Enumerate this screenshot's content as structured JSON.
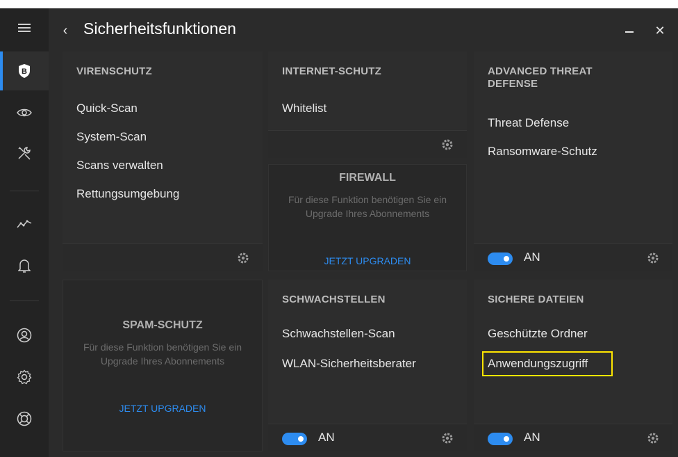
{
  "titlebar": {
    "back_glyph": "‹",
    "title": "Sicherheitsfunktionen",
    "close_glyph": "✕"
  },
  "sidebar": {
    "items": [
      {
        "icon": "menu-icon"
      },
      {
        "icon": "bitdefender-shield-icon",
        "glyph": "B",
        "active": true
      },
      {
        "icon": "eye-icon"
      },
      {
        "icon": "tools-icon"
      },
      {
        "icon": "activity-graph-icon"
      },
      {
        "icon": "bell-icon"
      },
      {
        "icon": "account-icon"
      },
      {
        "icon": "settings-icon"
      },
      {
        "icon": "support-icon"
      }
    ]
  },
  "cards": {
    "virenschutz": {
      "title": "VIRENSCHUTZ",
      "links": [
        "Quick-Scan",
        "System-Scan",
        "Scans verwalten",
        "Rettungsumgebung"
      ]
    },
    "internet": {
      "title": "INTERNET-SCHUTZ",
      "links": [
        "Whitelist"
      ]
    },
    "atd": {
      "title": "ADVANCED THREAT DEFENSE",
      "links": [
        "Threat Defense",
        "Ransomware-Schutz"
      ],
      "toggle_label": "AN"
    },
    "firewall": {
      "title": "FIREWALL",
      "desc": "Für diese Funktion benötigen Sie ein Upgrade Ihres Abonnements",
      "link": "JETZT UPGRADEN"
    },
    "spam": {
      "title": "SPAM-SCHUTZ",
      "desc": "Für diese Funktion benötigen Sie ein Upgrade Ihres Abonnements",
      "link": "JETZT UPGRADEN"
    },
    "schwach": {
      "title": "SCHWACHSTELLEN",
      "links": [
        "Schwachstellen-Scan",
        "WLAN-Sicherheitsberater"
      ],
      "toggle_label": "AN"
    },
    "sichere": {
      "title": "SICHERE DATEIEN",
      "links": [
        "Geschützte Ordner",
        "Anwendungszugriff"
      ],
      "toggle_label": "AN"
    }
  },
  "colors": {
    "accent": "#2d8cf0",
    "highlight": "#ffe600",
    "background": "#2b2b2b"
  }
}
